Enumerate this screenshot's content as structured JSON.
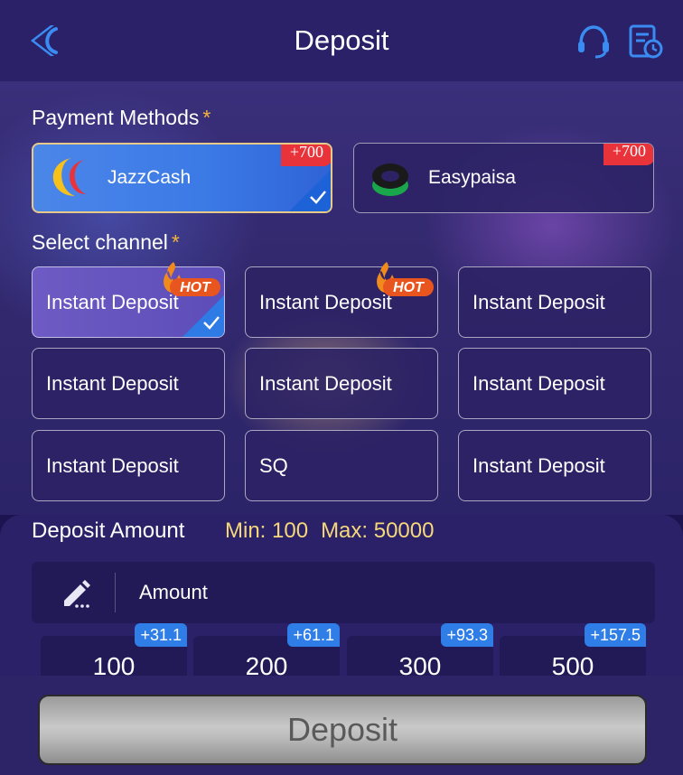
{
  "header": {
    "title": "Deposit"
  },
  "payment_methods": {
    "label": "Payment Methods",
    "required_mark": "*",
    "items": [
      {
        "name": "JazzCash",
        "bonus": "+700",
        "selected": true
      },
      {
        "name": "Easypaisa",
        "bonus": "+700",
        "selected": false
      }
    ]
  },
  "channels": {
    "label": "Select channel",
    "required_mark": "*",
    "hot_label": "HOT",
    "items": [
      {
        "label": "Instant Deposit",
        "hot": true,
        "selected": true
      },
      {
        "label": "Instant Deposit",
        "hot": true,
        "selected": false
      },
      {
        "label": "Instant Deposit",
        "hot": false,
        "selected": false
      },
      {
        "label": "Instant Deposit",
        "hot": false,
        "selected": false
      },
      {
        "label": "Instant Deposit",
        "hot": false,
        "selected": false
      },
      {
        "label": "Instant Deposit",
        "hot": false,
        "selected": false
      },
      {
        "label": "Instant Deposit",
        "hot": false,
        "selected": false
      },
      {
        "label": "SQ",
        "hot": false,
        "selected": false
      },
      {
        "label": "Instant Deposit",
        "hot": false,
        "selected": false
      }
    ]
  },
  "amount": {
    "title": "Deposit Amount",
    "min_text": "Min: 100",
    "max_text": "Max: 50000",
    "placeholder": "Amount",
    "presets": [
      {
        "value": "100",
        "bonus": "+31.1"
      },
      {
        "value": "200",
        "bonus": "+61.1"
      },
      {
        "value": "300",
        "bonus": "+93.3"
      },
      {
        "value": "500",
        "bonus": "+157.5"
      }
    ]
  },
  "footer": {
    "deposit_label": "Deposit"
  },
  "icons": {
    "back": "back-arrow-icon",
    "support": "headset-icon",
    "records": "records-icon",
    "edit": "pencil-icon",
    "check": "checkmark-icon",
    "hot": "flame-icon"
  },
  "colors": {
    "header_bg": "#2a2168",
    "selected_method": "#3b79e6",
    "bonus_red": "#e8333a",
    "bonus_blue": "#2f7de6",
    "limit_text": "#f6d87a",
    "required_mark": "#f5b33a"
  }
}
